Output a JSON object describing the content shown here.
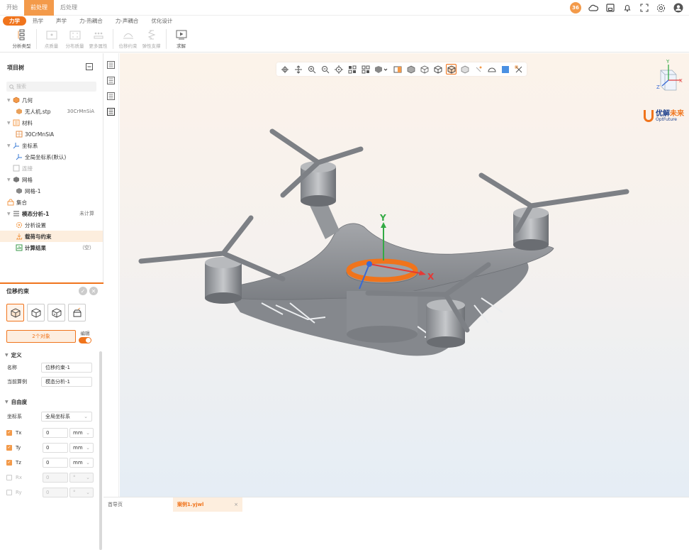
{
  "main_tabs": [
    {
      "label": "开始"
    },
    {
      "label": "前处理"
    },
    {
      "label": "后处理"
    }
  ],
  "main_tab_active": 1,
  "user_badge": "36",
  "sub_tabs": [
    {
      "label": "力学"
    },
    {
      "label": "热学"
    },
    {
      "label": "声学"
    },
    {
      "label": "力-热耦合"
    },
    {
      "label": "力-声耦合"
    },
    {
      "label": "优化设计"
    }
  ],
  "toolbar": {
    "analysis_type": "分析类型",
    "point_mass": "点质量",
    "distributed_mass": "分布质量",
    "more_attributes": "更多属性",
    "displacement": "位移约束",
    "elastic_support": "弹性支撑",
    "solve": "求解"
  },
  "tree": {
    "title": "项目树",
    "search_placeholder": "搜索",
    "items": [
      {
        "label": "几何",
        "extra": ""
      },
      {
        "label": "无人机.stp",
        "extra": "30CrMnSiA"
      },
      {
        "label": "材料",
        "extra": ""
      },
      {
        "label": "30CrMnSiA",
        "extra": ""
      },
      {
        "label": "坐标系",
        "extra": ""
      },
      {
        "label": "全局坐标系(默认)",
        "extra": ""
      },
      {
        "label": "连接",
        "extra": ""
      },
      {
        "label": "网格",
        "extra": ""
      },
      {
        "label": "网格-1",
        "extra": ""
      },
      {
        "label": "集合",
        "extra": ""
      },
      {
        "label": "模态分析-1",
        "extra": "未计算"
      },
      {
        "label": "分析设置",
        "extra": ""
      },
      {
        "label": "载荷与约束",
        "extra": ""
      },
      {
        "label": "计算结果",
        "extra": "（空）"
      }
    ]
  },
  "prop": {
    "title": "位移约束",
    "objects_btn": "2个对象",
    "edit_label": "编辑",
    "def_title": "定义",
    "name_label": "名称",
    "name_value": "位移约束-1",
    "case_label": "当前算例",
    "case_value": "模态分析-1",
    "dof_title": "自由度",
    "coord_label": "坐标系",
    "coord_value": "全局坐标系",
    "dofs": [
      {
        "label": "Tx",
        "value": "0",
        "unit": "mm",
        "checked": true
      },
      {
        "label": "Ty",
        "value": "0",
        "unit": "mm",
        "checked": true
      },
      {
        "label": "Tz",
        "value": "0",
        "unit": "mm",
        "checked": true
      },
      {
        "label": "Rx",
        "value": "0",
        "unit": "°",
        "checked": false
      },
      {
        "label": "Ry",
        "value": "0",
        "unit": "°",
        "checked": false
      }
    ]
  },
  "brand": {
    "cn_a": "优解",
    "cn_b": "未来",
    "en": "OptFuture"
  },
  "axis": {
    "x": "X",
    "y": "Y",
    "z": "Z"
  },
  "bottom_tabs": [
    {
      "label": "首导页"
    },
    {
      "label": "案例1.yjwl"
    }
  ],
  "colors": {
    "accent": "#f0741c",
    "model": "#8e9196"
  }
}
